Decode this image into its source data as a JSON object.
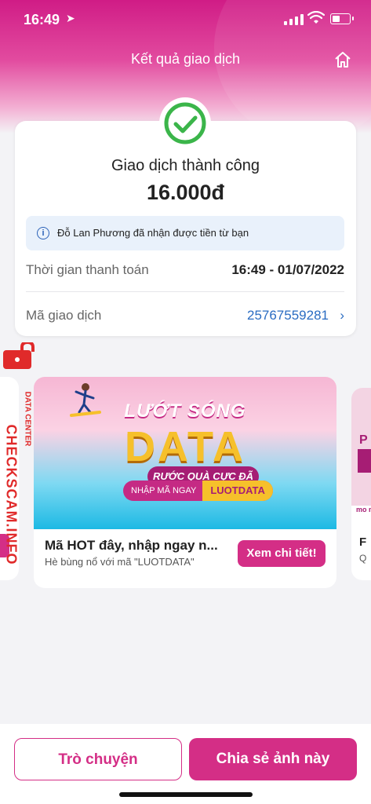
{
  "status_bar": {
    "time": "16:49",
    "location_icon": "location-arrow-icon"
  },
  "header": {
    "title": "Kết quả giao dịch",
    "home_icon": "home-icon"
  },
  "result": {
    "status": "Giao dịch thành công",
    "amount": "16.000đ",
    "info": "Đỗ Lan Phương đã nhận được tiền từ bạn",
    "rows": [
      {
        "label": "Thời gian thanh toán",
        "value": "16:49 - 01/07/2022"
      },
      {
        "label": "Mã giao dịch",
        "value": "25767559281"
      }
    ]
  },
  "promo": {
    "banner_line1": "LƯỚT SÓNG",
    "banner_line2": "DATA",
    "banner_line3": "RƯỚC QUÀ CỰC ĐÃ",
    "code_prefix": "NHẬP MÃ NGAY",
    "code": "LUOTDATA",
    "title": "Mã HOT đây, nhập ngay n...",
    "subtitle": "Hè bùng nổ với mã \"LUOTDATA\"",
    "button": "Xem chi tiết!"
  },
  "side_card_right": {
    "label": "P",
    "logo": "mo mo",
    "title": "F",
    "sub": "Q"
  },
  "watermark": {
    "line1": "CHECKSCAM.INFO",
    "line2": "DATA CENTER"
  },
  "actions": {
    "chat": "Trò chuyện",
    "share": "Chia sẻ ảnh này"
  },
  "colors": {
    "brand": "#d42e86",
    "success": "#3bb54a",
    "link": "#2a6cc2"
  }
}
